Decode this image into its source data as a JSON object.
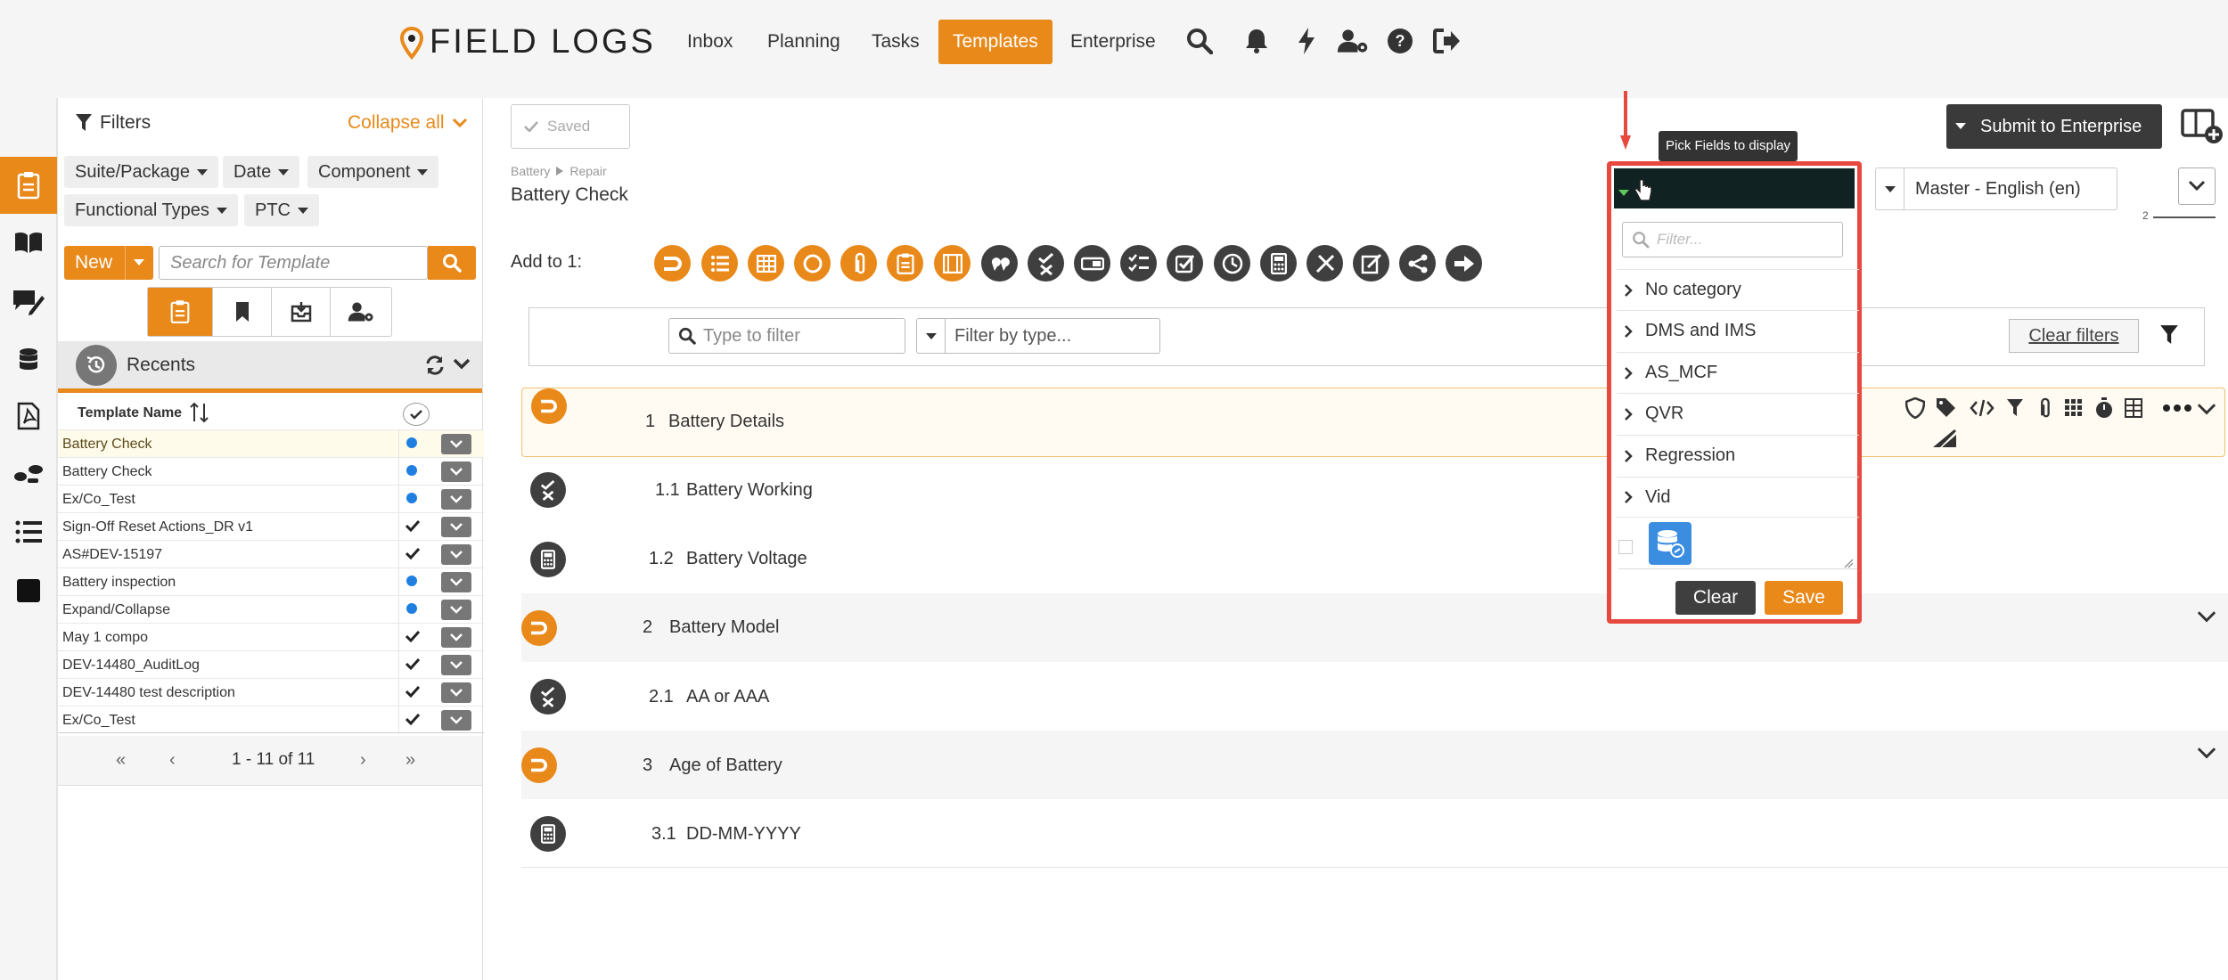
{
  "brand": {
    "name": "FIELD LOGS"
  },
  "nav": {
    "inbox": "Inbox",
    "planning": "Planning",
    "tasks": "Tasks",
    "templates": "Templates",
    "enterprise": "Enterprise"
  },
  "filters": {
    "title": "Filters",
    "collapse_all": "Collapse all",
    "chips": [
      "Suite/Package",
      "Date",
      "Component",
      "Functional Types",
      "PTC"
    ],
    "new_label": "New",
    "search_placeholder": "Search for Template"
  },
  "recents": {
    "title": "Recents",
    "column_header": "Template Name",
    "rows": [
      {
        "name": "Battery Check",
        "status": "dot",
        "highlight": true
      },
      {
        "name": "Battery Check",
        "status": "dot",
        "highlight": false
      },
      {
        "name": "Ex/Co_Test",
        "status": "dot",
        "highlight": false
      },
      {
        "name": "Sign-Off Reset Actions_DR v1",
        "status": "check",
        "highlight": false
      },
      {
        "name": "AS#DEV-15197",
        "status": "check",
        "highlight": false
      },
      {
        "name": "Battery inspection",
        "status": "dot",
        "highlight": false
      },
      {
        "name": "Expand/Collapse",
        "status": "dot",
        "highlight": false
      },
      {
        "name": "May 1 compo",
        "status": "check",
        "highlight": false
      },
      {
        "name": "DEV-14480_AuditLog",
        "status": "check",
        "highlight": false
      },
      {
        "name": "DEV-14480 test description",
        "status": "check",
        "highlight": false
      },
      {
        "name": "Ex/Co_Test",
        "status": "check",
        "highlight": false
      }
    ],
    "pagination": "1 - 11 of 11"
  },
  "editor": {
    "saved_label": "Saved",
    "breadcrumb": [
      "Battery",
      "Repair"
    ],
    "template_title": "Battery Check",
    "add_to_label": "Add to 1:",
    "submit_label": "Submit to Enterprise",
    "language": "Master - English (en)",
    "type_filter_placeholder": "Type to filter",
    "type_select_placeholder": "Filter by type...",
    "clear_filters": "Clear filters",
    "small_number": "2"
  },
  "questions": [
    {
      "num": "1",
      "title": "Battery Details",
      "kind": "section",
      "shade": "highlight"
    },
    {
      "num": "1.1",
      "title": "Battery Working",
      "kind": "yesno",
      "shade": "none"
    },
    {
      "num": "1.2",
      "title": "Battery Voltage",
      "kind": "calc",
      "shade": "none"
    },
    {
      "num": "2",
      "title": "Battery Model",
      "kind": "section",
      "shade": "grey"
    },
    {
      "num": "2.1",
      "title": "AA or AAA",
      "kind": "yesno",
      "shade": "none"
    },
    {
      "num": "3",
      "title": "Age of Battery",
      "kind": "section",
      "shade": "grey"
    },
    {
      "num": "3.1",
      "title": "DD-MM-YYYY",
      "kind": "calc",
      "shade": "none"
    }
  ],
  "popup": {
    "tooltip": "Pick Fields to display",
    "filter_placeholder": "Filter...",
    "categories": [
      "No category",
      "DMS and IMS",
      "AS_MCF",
      "QVR",
      "Regression",
      "Vid"
    ],
    "clear_label": "Clear",
    "save_label": "Save"
  },
  "colors": {
    "accent": "#e8891a",
    "dark": "#3f3f3f",
    "highlight_border": "#e8493f",
    "blue_dot": "#1f7fe0"
  }
}
